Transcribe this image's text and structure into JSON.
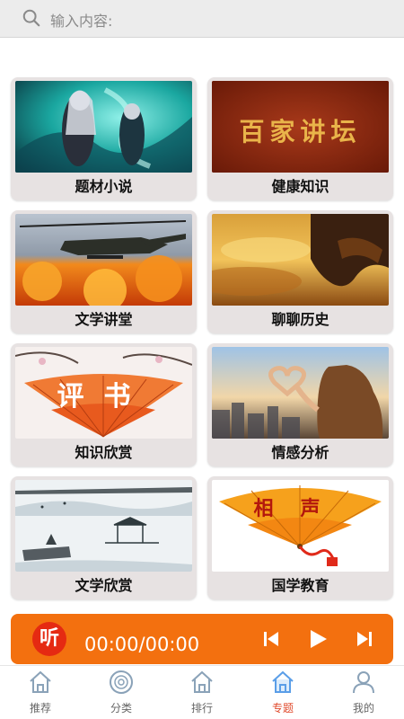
{
  "search": {
    "placeholder": "输入内容:",
    "icon": "search-icon"
  },
  "categories": [
    {
      "label": "题材小说",
      "thumb": "anime-warrior-image"
    },
    {
      "label": "健康知识",
      "thumb": "baijia-jiangtan-banner",
      "thumb_text": "百家讲坛"
    },
    {
      "label": "文学讲堂",
      "thumb": "helicopter-explosion-image"
    },
    {
      "label": "聊聊历史",
      "thumb": "dragon-roof-sunset-image"
    },
    {
      "label": "知识欣赏",
      "thumb": "pingshu-fan-image",
      "thumb_text": "评书"
    },
    {
      "label": "情感分析",
      "thumb": "heart-hands-image"
    },
    {
      "label": "文学欣赏",
      "thumb": "ink-landscape-pavilion-image"
    },
    {
      "label": "国学教育",
      "thumb": "xiangsheng-fan-image",
      "thumb_text": "相声"
    }
  ],
  "player": {
    "listen_label": "听",
    "time": "00:00/00:00",
    "controls": [
      "previous-icon",
      "play-icon",
      "next-icon"
    ],
    "color": "#f3700f"
  },
  "tabs": [
    {
      "label": "推荐",
      "icon": "home-icon"
    },
    {
      "label": "分类",
      "icon": "disc-icon"
    },
    {
      "label": "排行",
      "icon": "home-icon"
    },
    {
      "label": "专题",
      "icon": "home-icon",
      "active": true
    },
    {
      "label": "我的",
      "icon": "user-icon"
    }
  ],
  "colors": {
    "active_tab": "#e04a2c",
    "card_bg": "#e7e2e2"
  }
}
